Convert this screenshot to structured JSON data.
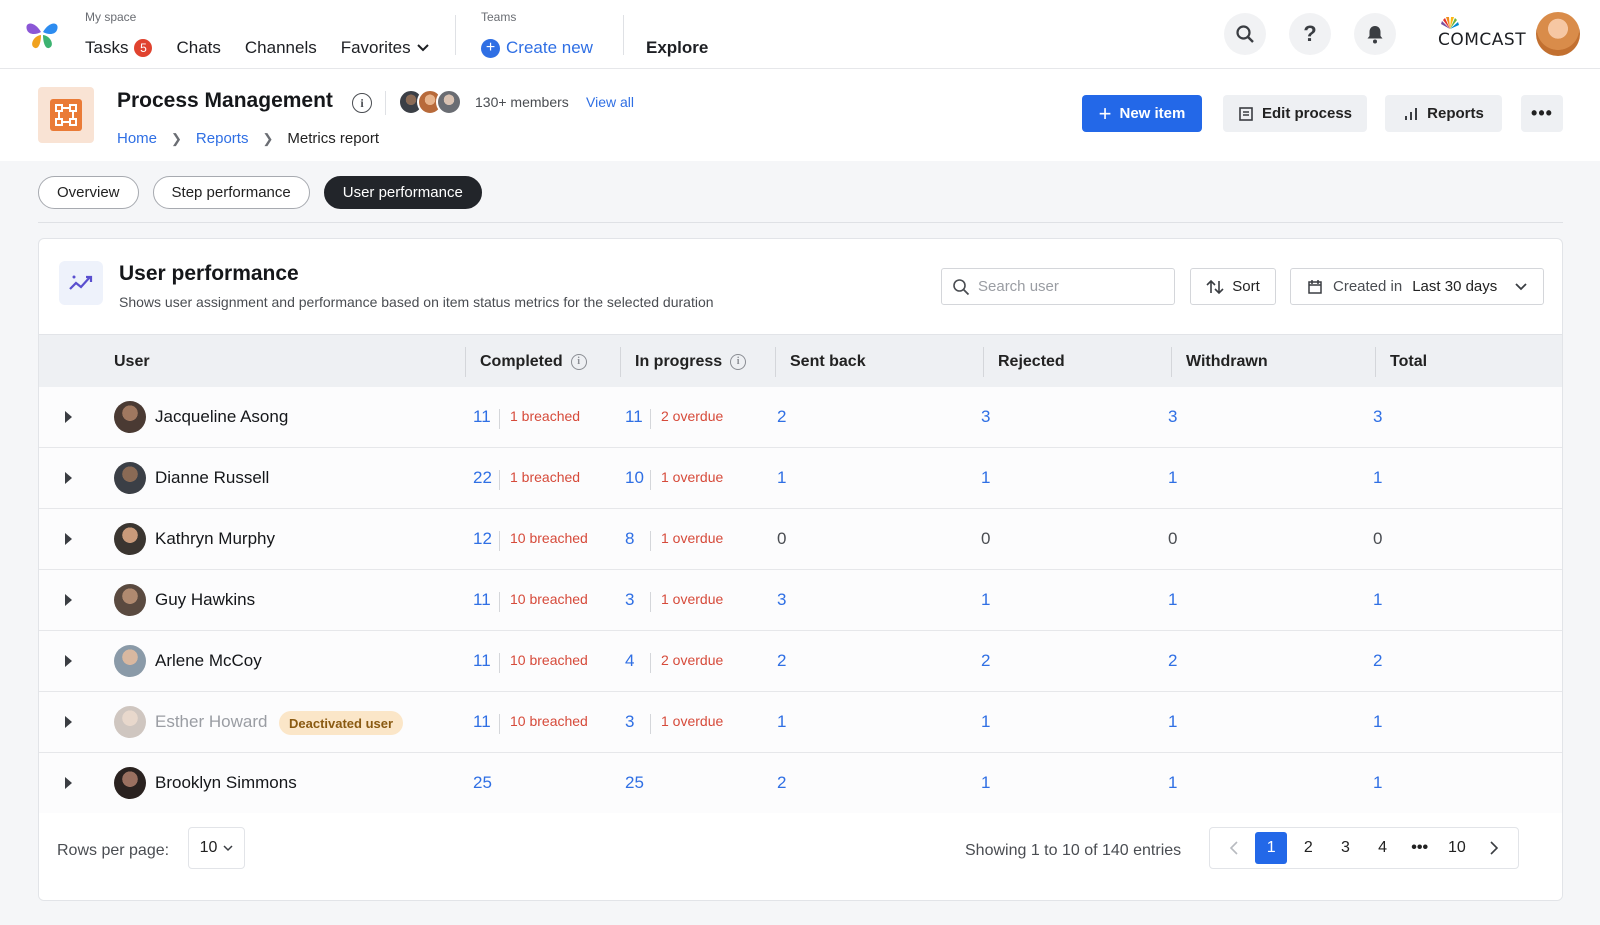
{
  "topnav": {
    "myspace_caption": "My space",
    "tasks_label": "Tasks",
    "tasks_count": "5",
    "chats_label": "Chats",
    "channels_label": "Channels",
    "favorites_label": "Favorites",
    "teams_caption": "Teams",
    "create_new_label": "Create new",
    "explore_label": "Explore",
    "brand": "COMCAST"
  },
  "header": {
    "title": "Process Management",
    "members": "130+ members",
    "view_all": "View all",
    "breadcrumb": [
      "Home",
      "Reports",
      "Metrics report"
    ],
    "new_item": "New item",
    "edit_process": "Edit process",
    "reports": "Reports"
  },
  "tabs": [
    "Overview",
    "Step performance",
    "User performance"
  ],
  "panel": {
    "title": "User performance",
    "subtitle": "Shows user assignment and performance based on item status metrics for the selected duration",
    "search_placeholder": "Search user",
    "sort_label": "Sort",
    "date_prefix": "Created in",
    "date_value": "Last 30 days"
  },
  "table": {
    "columns": [
      "User",
      "Completed",
      "In progress",
      "Sent back",
      "Rejected",
      "Withdrawn",
      "Total"
    ],
    "rows": [
      {
        "name": "Jacqueline Asong",
        "completed": "11",
        "breached": "1 breached",
        "in_progress": "11",
        "overdue": "2 overdue",
        "sent_back": "2",
        "rejected": "3",
        "withdrawn": "3",
        "total": "3",
        "deactivated": ""
      },
      {
        "name": "Dianne Russell",
        "completed": "22",
        "breached": "1 breached",
        "in_progress": "10",
        "overdue": "1 overdue",
        "sent_back": "1",
        "rejected": "1",
        "withdrawn": "1",
        "total": "1",
        "deactivated": ""
      },
      {
        "name": "Kathryn Murphy",
        "completed": "12",
        "breached": "10 breached",
        "in_progress": "8",
        "overdue": "1 overdue",
        "sent_back": "0",
        "rejected": "0",
        "withdrawn": "0",
        "total": "0",
        "deactivated": ""
      },
      {
        "name": "Guy Hawkins",
        "completed": "11",
        "breached": "10 breached",
        "in_progress": "3",
        "overdue": "1 overdue",
        "sent_back": "3",
        "rejected": "1",
        "withdrawn": "1",
        "total": "1",
        "deactivated": ""
      },
      {
        "name": "Arlene McCoy",
        "completed": "11",
        "breached": "10 breached",
        "in_progress": "4",
        "overdue": "2 overdue",
        "sent_back": "2",
        "rejected": "2",
        "withdrawn": "2",
        "total": "2",
        "deactivated": ""
      },
      {
        "name": "Esther Howard",
        "completed": "11",
        "breached": "10 breached",
        "in_progress": "3",
        "overdue": "1 overdue",
        "sent_back": "1",
        "rejected": "1",
        "withdrawn": "1",
        "total": "1",
        "deactivated": "Deactivated user"
      },
      {
        "name": "Brooklyn Simmons",
        "completed": "25",
        "breached": "",
        "in_progress": "25",
        "overdue": "",
        "sent_back": "2",
        "rejected": "1",
        "withdrawn": "1",
        "total": "1",
        "deactivated": ""
      }
    ]
  },
  "footer": {
    "rows_per_page_label": "Rows per page:",
    "rows_per_page_value": "10",
    "showing": "Showing 1 to 10 of 140 entries",
    "pages": [
      "1",
      "2",
      "3",
      "4",
      "10"
    ],
    "current_page": "1"
  },
  "colors": {
    "accent": "#2368e8",
    "link": "#2f6fe4",
    "danger": "#d64a3a",
    "app_icon": "#ea7b37"
  }
}
